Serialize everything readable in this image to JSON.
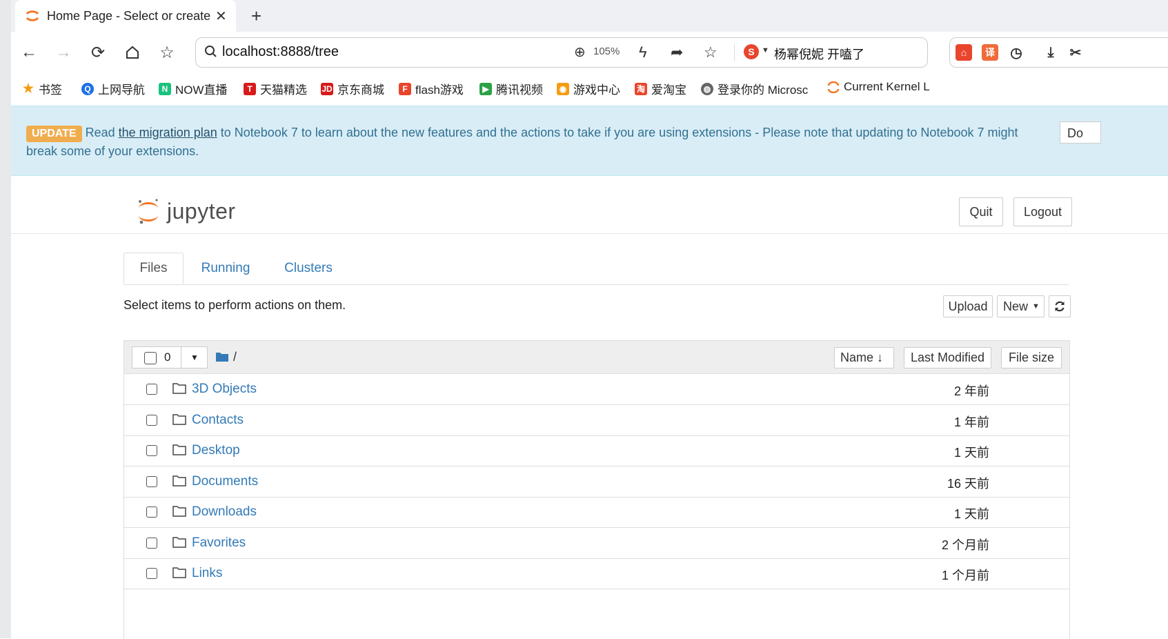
{
  "browser": {
    "tab_title": "Home Page - Select or create",
    "url": "localhost:8888/tree",
    "zoom": "105%",
    "hot_search": "杨幂倪妮 开嗑了"
  },
  "bookmarks": [
    {
      "label": "书签",
      "icon": "star-icon",
      "color": "#f39c12"
    },
    {
      "label": "上网导航",
      "icon": "q-icon",
      "color": "#1e6fe8"
    },
    {
      "label": "NOW直播",
      "icon": "now-icon",
      "color": "#19c37d"
    },
    {
      "label": "天猫精选",
      "icon": "tmall-icon",
      "color": "#d71a1a"
    },
    {
      "label": "京东商城",
      "icon": "jd-icon",
      "color": "#d71a1a"
    },
    {
      "label": "flash游戏",
      "icon": "flash-icon",
      "color": "#e8452c"
    },
    {
      "label": "腾讯视频",
      "icon": "play-icon",
      "color": "#2ba245"
    },
    {
      "label": "游戏中心",
      "icon": "gamepad-icon",
      "color": "#f39c12"
    },
    {
      "label": "爱淘宝",
      "icon": "taobao-icon",
      "color": "#e8452c"
    },
    {
      "label": "登录你的 Microsc",
      "icon": "globe-icon",
      "color": "#666666"
    },
    {
      "label": "Current Kernel L",
      "icon": "jupyter-icon",
      "color": "#f37726"
    }
  ],
  "alert": {
    "badge": "UPDATE",
    "read": "Read",
    "link": "the migration plan",
    "text": "to Notebook 7 to learn about the new features and the actions to take if you are using extensions - Please note that updating to Notebook 7 might break some of your extensions.",
    "dismiss": "Do"
  },
  "header": {
    "logo_text": "jupyter",
    "quit": "Quit",
    "logout": "Logout"
  },
  "nav_tabs": [
    "Files",
    "Running",
    "Clusters"
  ],
  "toolbar": {
    "hint": "Select items to perform actions on them.",
    "upload": "Upload",
    "new": "New"
  },
  "list_header": {
    "selected_count": "0",
    "path": "/",
    "name": "Name",
    "last_modified": "Last Modified",
    "file_size": "File size"
  },
  "files": [
    {
      "name": "3D Objects",
      "modified": "2 年前"
    },
    {
      "name": "Contacts",
      "modified": "1 年前"
    },
    {
      "name": "Desktop",
      "modified": "1 天前"
    },
    {
      "name": "Documents",
      "modified": "16 天前"
    },
    {
      "name": "Downloads",
      "modified": "1 天前"
    },
    {
      "name": "Favorites",
      "modified": "2 个月前"
    },
    {
      "name": "Links",
      "modified": "1 个月前"
    }
  ],
  "colors": {
    "link": "#337ab7",
    "alert_bg": "#d9edf7",
    "badge": "#f0ad4e",
    "jupyter_orange": "#f37726"
  }
}
